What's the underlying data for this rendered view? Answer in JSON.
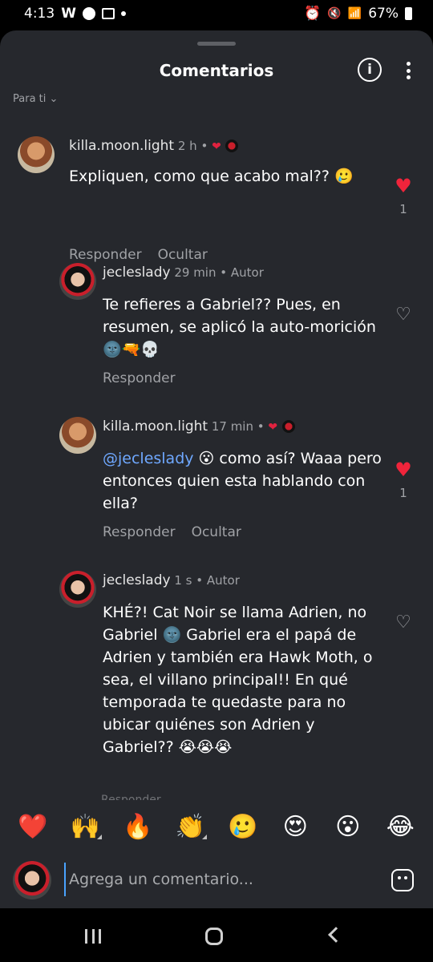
{
  "status": {
    "time": "4:13",
    "carrier": "W",
    "battery": "67%"
  },
  "header": {
    "title": "Comentarios",
    "info_label": "i",
    "sort_label": "Para ti ⌄"
  },
  "comments": [
    {
      "user": "killa.moon.light",
      "time": "2 h",
      "meta_sep": " • ",
      "text": "Expliquen, como que acabo mal?? 🥲",
      "reply": "Responder",
      "hide": "Ocultar",
      "likes": "1"
    },
    {
      "user": "jecleslady",
      "time": "29 min",
      "meta_sep": " • ",
      "author": "Autor",
      "text": "Te refieres a Gabriel?? Pues, en resumen, se aplicó la auto-morición 🌚🔫💀",
      "reply": "Responder"
    },
    {
      "user": "killa.moon.light",
      "time": "17 min",
      "meta_sep": " • ",
      "mention": "@jecleslady",
      "text": " 😮 como así? Waaa pero entonces quien esta hablando con ella?",
      "reply": "Responder",
      "hide": "Ocultar",
      "likes": "1"
    },
    {
      "user": "jecleslady",
      "time": "1 s",
      "meta_sep": " • ",
      "author": "Autor",
      "text": "KHÉ?! Cat Noir se llama Adrien, no Gabriel 🌚 Gabriel era el papá de Adrien y también era Hawk Moth, o sea, el villano principal!! En qué temporada te quedaste para no ubicar quiénes son Adrien y Gabriel?? 😭😭😭",
      "reply": "Responder"
    }
  ],
  "reactions": [
    "❤️",
    "🙌",
    "🔥",
    "👏",
    "🥲",
    "😍",
    "😮",
    "😂"
  ],
  "composer": {
    "placeholder": "Agrega un comentario..."
  }
}
